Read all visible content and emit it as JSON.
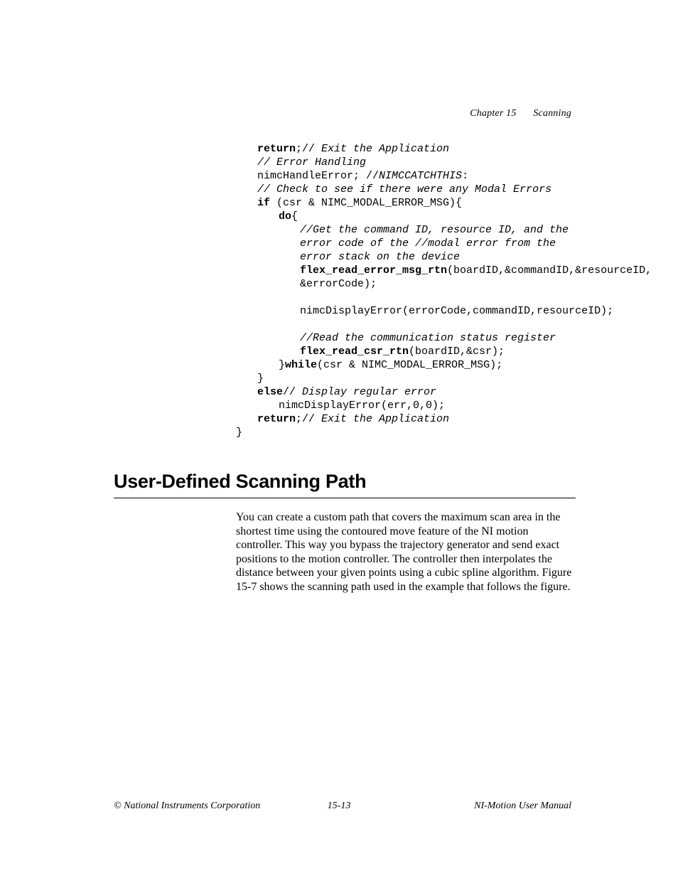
{
  "header": {
    "chapter": "Chapter 15",
    "title": "Scanning"
  },
  "code": {
    "l01_a": "return",
    "l01_b": ";// ",
    "l01_c": "Exit the Application",
    "l02": "// Error Handling",
    "l03_a": "nimcHandleError; //",
    "l03_b": "NIMCCATCHTHIS",
    "l03_c": ":",
    "l04": "// Check to see if there were any Modal Errors",
    "l05_a": "if",
    "l05_b": " (csr & NIMC_MODAL_ERROR_MSG){",
    "l06_a": "do",
    "l06_b": "{",
    "l07": "//Get the command ID, resource ID, and the error code of the //modal error from the error stack on the device",
    "l08_a": "flex_read_error_msg_rtn",
    "l08_b": "(boardID,&commandID,&resourceID, &errorCode);",
    "l09": "nimcDisplayError(errorCode,commandID,resourceID);",
    "l10": "//Read the communication status register",
    "l11_a": "flex_read_csr_rtn",
    "l11_b": "(boardID,&csr);",
    "l12_a": "}",
    "l12_b": "while",
    "l12_c": "(csr & NIMC_MODAL_ERROR_MSG);",
    "l13": "}",
    "l14_a": "else",
    "l14_b": "// ",
    "l14_c": "Display regular error",
    "l15": "nimcDisplayError(err,0,0);",
    "l16_a": "return",
    "l16_b": ";// ",
    "l16_c": "Exit the Application",
    "l17": "}"
  },
  "heading": "User-Defined Scanning Path",
  "paragraph": "You can create a custom path that covers the maximum scan area in the shortest time using the contoured move feature of the NI motion controller. This way you bypass the trajectory generator and send exact positions to the motion controller. The controller then interpolates the distance between your given points using a cubic spline algorithm. Figure 15-7 shows the scanning path used in the example that follows the figure.",
  "footer": {
    "left": "© National Instruments Corporation",
    "center": "15-13",
    "right": "NI-Motion User Manual"
  }
}
